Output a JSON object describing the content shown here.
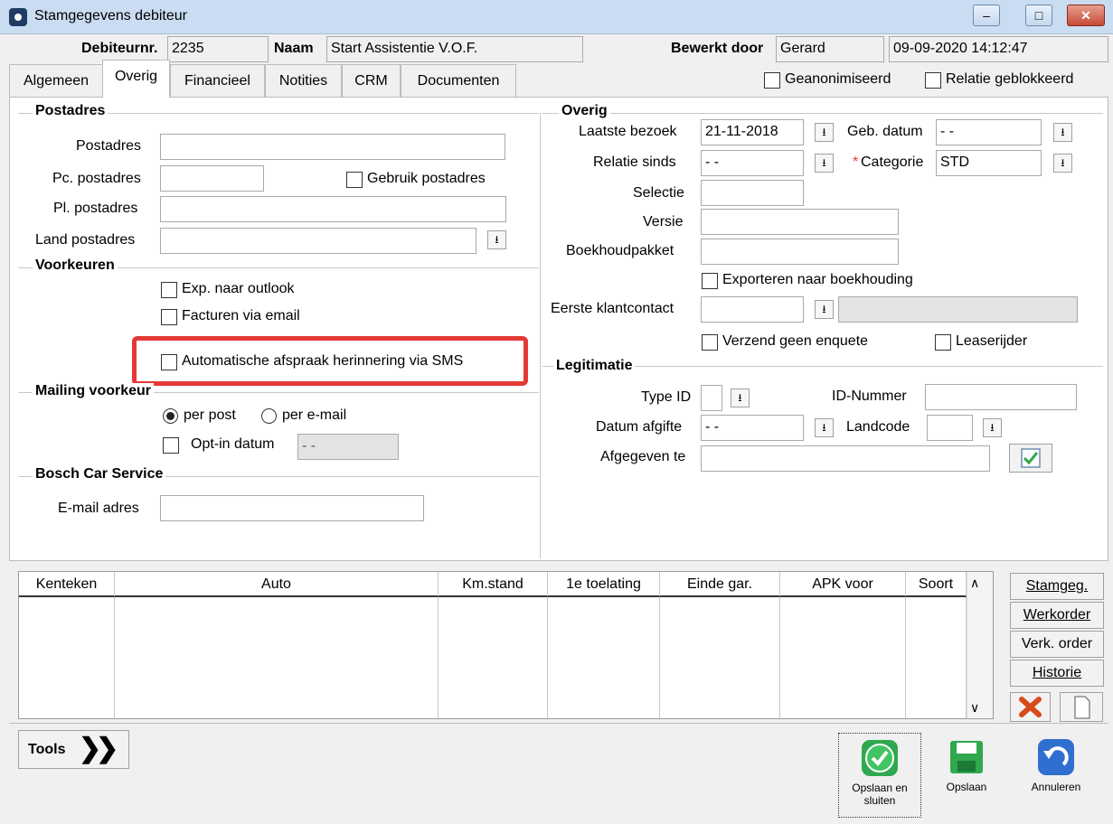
{
  "window": {
    "title": "Stamgegevens debiteur",
    "minimize": "–",
    "maximize": "□",
    "close": "✕"
  },
  "header": {
    "debiteurnr_label": "Debiteurnr.",
    "debiteurnr": "2235",
    "naam_label": "Naam",
    "naam": "Start Assistentie V.O.F.",
    "bewerkt_label": "Bewerkt door",
    "bewerkt_door": "Gerard",
    "datetime": "09-09-2020 14:12:47"
  },
  "tabs": [
    "Algemeen",
    "Overig",
    "Financieel",
    "Notities",
    "CRM",
    "Documenten"
  ],
  "flags": {
    "geanonimiseerd": "Geanonimiseerd",
    "relatie_geblokkeerd": "Relatie geblokkeerd"
  },
  "postadres": {
    "title": "Postadres",
    "postadres_label": "Postadres",
    "pc_label": "Pc. postadres",
    "gebruik_label": "Gebruik postadres",
    "pl_label": "Pl. postadres",
    "land_label": "Land postadres"
  },
  "voorkeuren": {
    "title": "Voorkeuren",
    "exp_outlook": "Exp. naar outlook",
    "facturen_email": "Facturen via email",
    "sms": "Automatische afspraak herinnering via SMS"
  },
  "mailing": {
    "title": "Mailing voorkeur",
    "per_post": "per post",
    "per_email": "per e-mail",
    "optin_label": "Opt-in datum",
    "optin_value": "- -"
  },
  "bosch": {
    "title": "Bosch Car Service",
    "email_label": "E-mail adres"
  },
  "overig": {
    "title": "Overig",
    "laatste_bezoek_label": "Laatste bezoek",
    "laatste_bezoek": "21-11-2018",
    "geb_datum_label": "Geb. datum",
    "geb_datum": "- -",
    "relatie_sinds_label": "Relatie sinds",
    "relatie_sinds": "- -",
    "required_mark": "*",
    "categorie_label": "Categorie",
    "categorie": "STD",
    "selectie_label": "Selectie",
    "versie_label": "Versie",
    "boekhoud_label": "Boekhoudpakket",
    "exporteren_label": "Exporteren naar boekhouding",
    "eerste_label": "Eerste klantcontact",
    "verzend_label": "Verzend geen enquete",
    "leaserijder_label": "Leaserijder"
  },
  "legitimatie": {
    "title": "Legitimatie",
    "type_label": "Type ID",
    "idnummer_label": "ID-Nummer",
    "afgifte_label": "Datum afgifte",
    "afgifte": "- -",
    "landcode_label": "Landcode",
    "afgegeven_label": "Afgegeven te"
  },
  "grid": {
    "columns": [
      "Kenteken",
      "Auto",
      "Km.stand",
      "1e toelating",
      "Einde gar.",
      "APK voor",
      "Soort"
    ],
    "scroll_up": "∧",
    "scroll_down": "∨"
  },
  "side_buttons": [
    "Stamgeg.",
    "Werkorder",
    "Verk. order",
    "Historie"
  ],
  "tools": {
    "label": "Tools",
    "arrows": "❯❯"
  },
  "actions": {
    "save_close_1": "Opslaan en",
    "save_close_2": "sluiten",
    "save": "Opslaan",
    "cancel": "Annuleren"
  },
  "colors": {
    "highlight": "#e53935",
    "titlebar": "#c9dcf2",
    "save_green": "#2fa84f",
    "cancel_blue": "#2f6fcf"
  }
}
